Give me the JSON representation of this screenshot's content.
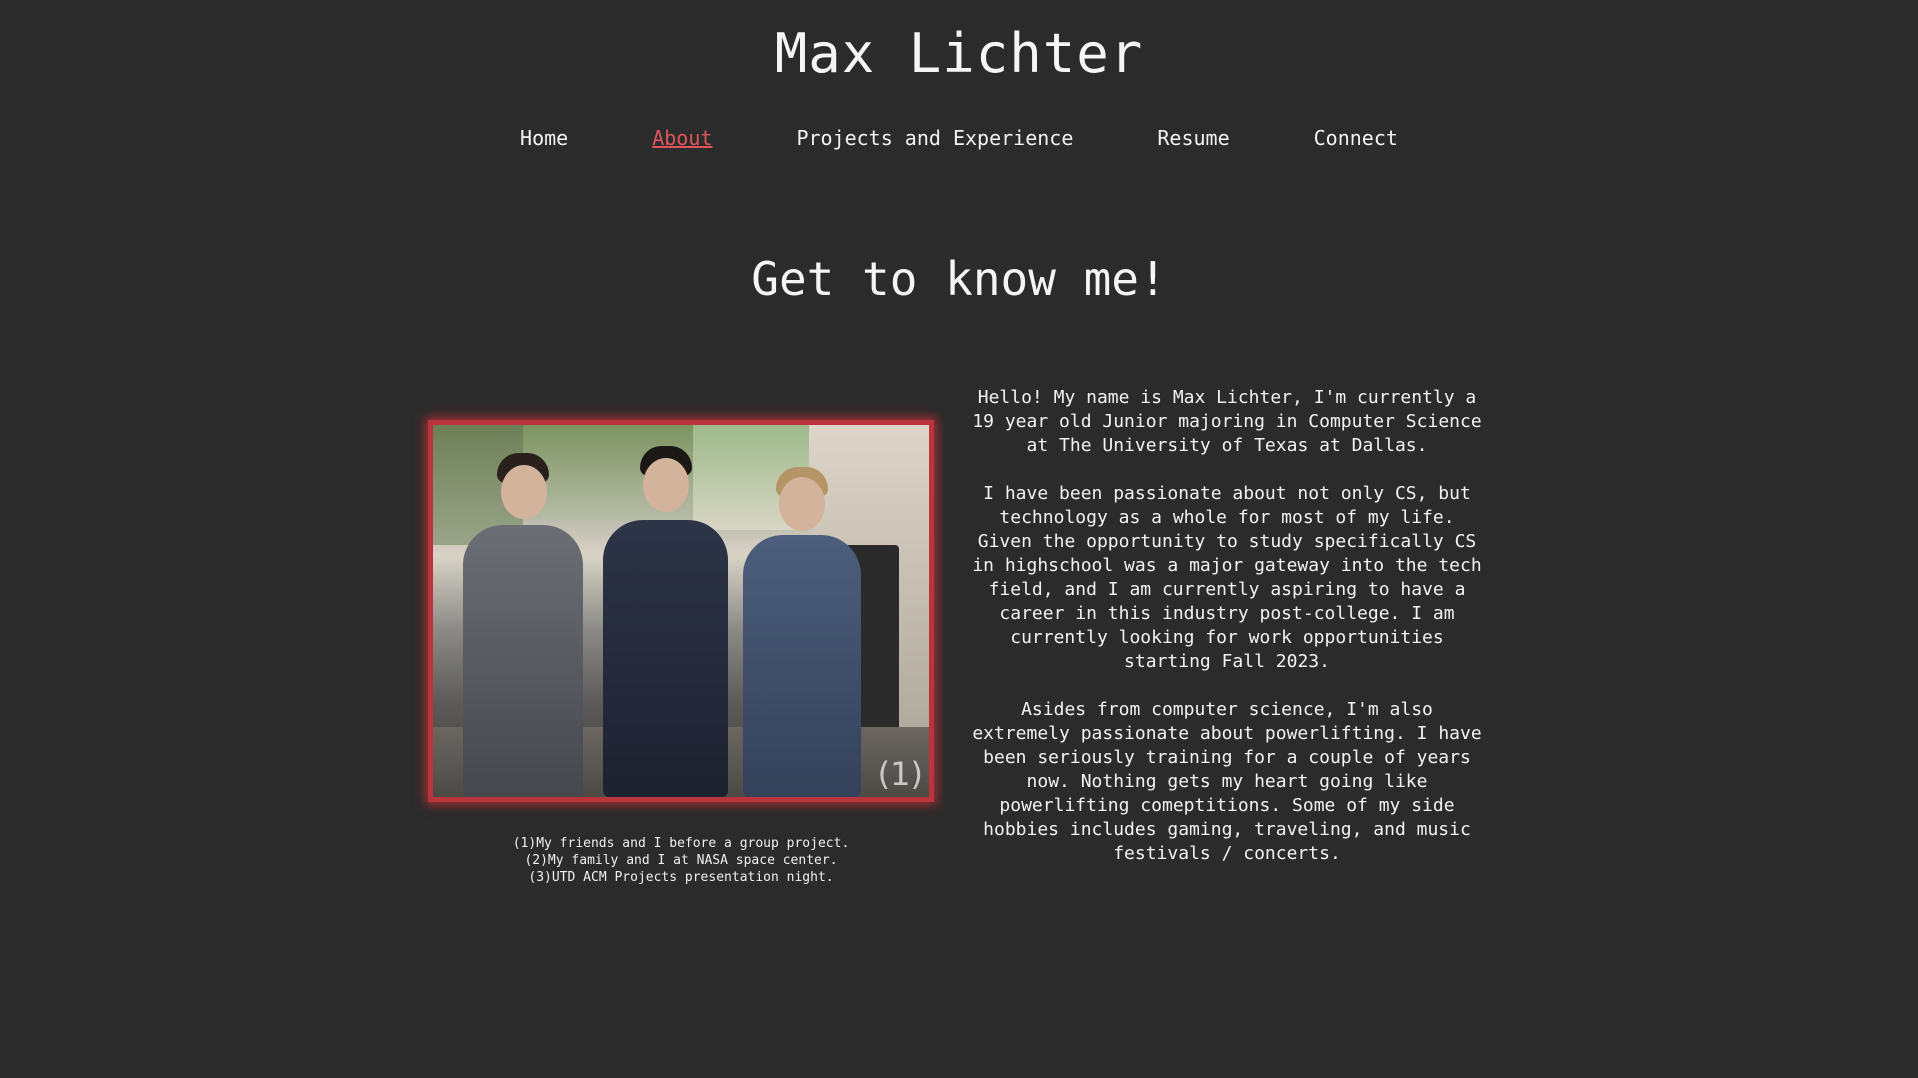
{
  "header": {
    "title": "Max Lichter"
  },
  "nav": {
    "items": [
      {
        "label": "Home",
        "active": false
      },
      {
        "label": "About",
        "active": true
      },
      {
        "label": "Projects and Experience",
        "active": false
      },
      {
        "label": "Resume",
        "active": false
      },
      {
        "label": "Connect",
        "active": false
      }
    ]
  },
  "main": {
    "heading": "Get to know me!",
    "photo": {
      "marker": "(1)",
      "captions": [
        "(1)My friends and I before a group project.",
        "(2)My family and I at NASA space center.",
        "(3)UTD ACM Projects presentation night."
      ]
    },
    "bio": {
      "paragraphs": [
        "Hello! My name is Max Lichter, I'm currently a 19 year old Junior majoring in Computer Science at The University of Texas at Dallas.",
        "I have been passionate about not only CS, but technology as a whole for most of my life. Given the opportunity to study specifically CS in highschool was a major gateway into the tech field, and I am currently aspiring to have a career in this industry post-college. I am currently looking for work opportunities starting Fall 2023.",
        "Asides from computer science, I'm also extremely passionate about powerlifting. I have been seriously training for a couple of years now. Nothing gets my heart going like powerlifting comeptitions. Some of my side hobbies includes gaming, traveling, and music festivals / concerts."
      ]
    }
  },
  "colors": {
    "background": "#2b2b2b",
    "text": "#f2f2f2",
    "accent": "#e0555a",
    "frame": "#b9353b"
  }
}
